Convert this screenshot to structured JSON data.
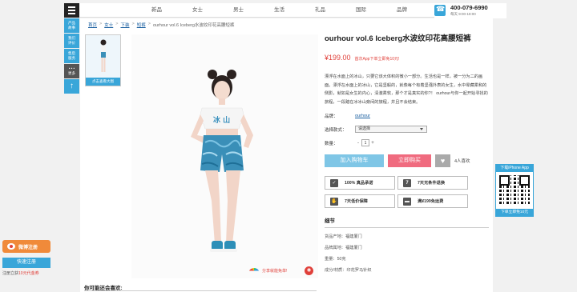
{
  "nav": {
    "items": [
      "新品",
      "女士",
      "男士",
      "生活",
      "礼品",
      "国际",
      "品牌"
    ]
  },
  "contact": {
    "phone": "400-079-6990",
    "hours": "每天 9:00-18:00"
  },
  "sidebar": {
    "tabs": [
      {
        "label": "产品\n故事"
      },
      {
        "label": "我们\n评价"
      },
      {
        "label": "售后\n服务"
      },
      {
        "label": "• • •\n更多"
      },
      {
        "label": "↑"
      }
    ]
  },
  "breadcrumb": {
    "items": [
      "首页",
      "女士",
      "下装",
      "短裤"
    ],
    "current": "ourhour vol.6 Iceberg水波纹印花高腰短裤",
    "separator": ">"
  },
  "gallery": {
    "thumb_caption": "点击查看大图"
  },
  "share": {
    "label": "分享就能免单!"
  },
  "product": {
    "title": "ourhour vol.6 Iceberg水波纹印花高腰短裤",
    "price": "¥199.00",
    "app_promo": "首次App下单立即免10元!",
    "description": "漂浮在水面上的冰山，只要它该大体积的微小一部分。生活也是一样，被一分为二的画面。漂浮在水面上的冰山，它是坚毅的，就像每个有着坚强外表的女生，水中晕藏柔和的侧影，就如是女生的内心，清澈柔软，那个才是真实的你?！ ourhour与你一起开始寻找的旅程，一段踏在冰冰山旁间的旅程，并且不会结束。",
    "brand_label": "品牌：",
    "brand_value": "ourhour",
    "style_label": "选择款式：",
    "style_value": "请选择",
    "qty_label": "数量：",
    "qty_minus": "-",
    "qty_value": "1",
    "qty_plus": "+",
    "add_cart": "加入购物车",
    "buy_now": "立即购买",
    "like_icon": "heart-icon",
    "like_count": "4人喜欢"
  },
  "guarantees": [
    {
      "icon": "authentic-icon",
      "label": "100% 真品承诺"
    },
    {
      "icon": "calendar-7-icon",
      "label": "7天无条件退换"
    },
    {
      "icon": "handshake-icon",
      "label": "7天低价保障"
    },
    {
      "icon": "truck-icon",
      "label": "满¥199免运费"
    }
  ],
  "details": {
    "title": "细节",
    "specs": [
      "货品产地：福建厦门",
      "品牌属地：福建厦门",
      "重量：50克",
      "成分/材质：印花罗马针织"
    ]
  },
  "recommend": {
    "title": "你可能还会喜欢:"
  },
  "qr": {
    "title": "下载iPhone App",
    "caption": "下单立即免10元"
  },
  "weibo": {
    "register": "微博注册",
    "quick": "快速注册",
    "bonus_prefix": "注册立获",
    "bonus_highlight": "10元代金券"
  },
  "colors": {
    "accent_blue": "#39a6d9",
    "price_red": "#e0403a",
    "buy_pink": "#f06b7f",
    "cart_blue": "#7fc6e6"
  }
}
